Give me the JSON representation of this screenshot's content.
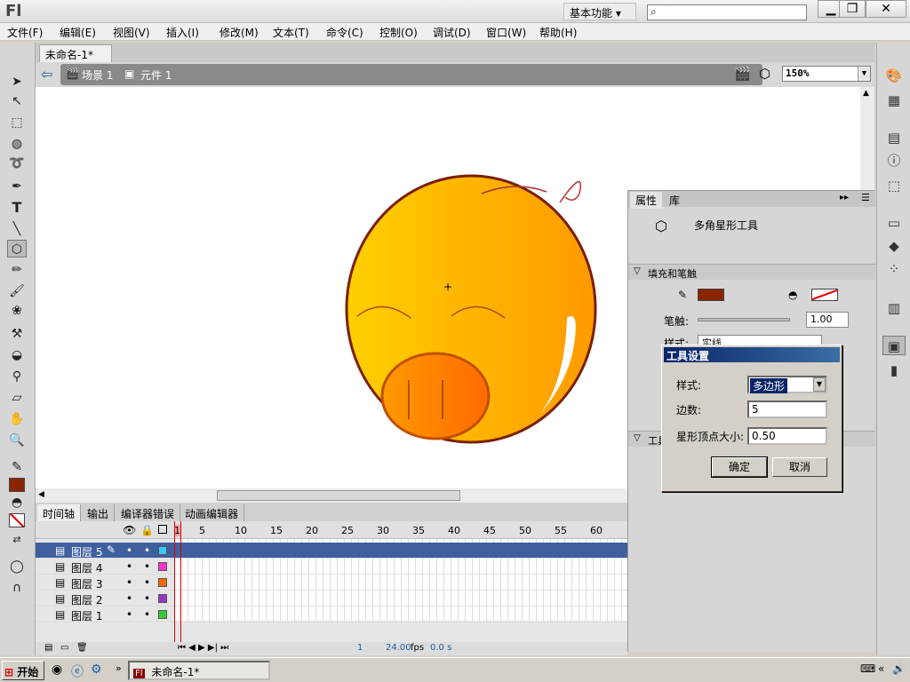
{
  "app": {
    "logo": "Fl",
    "workspace": "基本功能 ▾",
    "win_min": "▁",
    "win_max": "❐",
    "win_close": "✕"
  },
  "menu": [
    "文件(F)",
    "编辑(E)",
    "视图(V)",
    "插入(I)",
    "修改(M)",
    "文本(T)",
    "命令(C)",
    "控制(O)",
    "调试(D)",
    "窗口(W)",
    "帮助(H)"
  ],
  "document": {
    "tab_title": "未命名-1*",
    "close": "×"
  },
  "breadcrumb": {
    "scene": "场景 1",
    "symbol": "元件 1"
  },
  "zoom": "150%",
  "timeline": {
    "tabs": [
      "时间轴",
      "输出",
      "编译器错误",
      "动画编辑器"
    ],
    "frame_numbers": [
      "1",
      "5",
      "10",
      "15",
      "20",
      "25",
      "30",
      "35",
      "40",
      "45",
      "50",
      "55",
      "60"
    ],
    "layers": [
      {
        "name": "图层 5",
        "color": "#33ccff",
        "selected": true
      },
      {
        "name": "图层 4",
        "color": "#ff33cc",
        "selected": false
      },
      {
        "name": "图层 3",
        "color": "#ff6600",
        "selected": false
      },
      {
        "name": "图层 2",
        "color": "#9933cc",
        "selected": false
      },
      {
        "name": "图层 1",
        "color": "#33cc33",
        "selected": false
      }
    ],
    "footer": {
      "frame": "1",
      "fps": "24.00",
      "fps_unit": "fps",
      "time": "0.0 s"
    }
  },
  "properties": {
    "tabs": [
      "属性",
      "库"
    ],
    "tool_name": "多角星形工具",
    "section_fill": "填充和笔触",
    "stroke_color": "#8b2500",
    "stroke_label": "笔触:",
    "stroke_value": "1.00",
    "style_label": "样式:",
    "style_value": "实线",
    "section_tool": "工具"
  },
  "dialog": {
    "title": "工具设置",
    "style_label": "样式:",
    "style_value": "多边形",
    "sides_label": "边数:",
    "sides_value": "5",
    "star_label": "星形顶点大小:",
    "star_value": "0.50",
    "ok": "确定",
    "cancel": "取消"
  },
  "taskbar": {
    "start": "开始",
    "item": "未命名-1*"
  },
  "colors": {
    "accent": "#0a246a",
    "fill_swatch": "#8b2500"
  }
}
